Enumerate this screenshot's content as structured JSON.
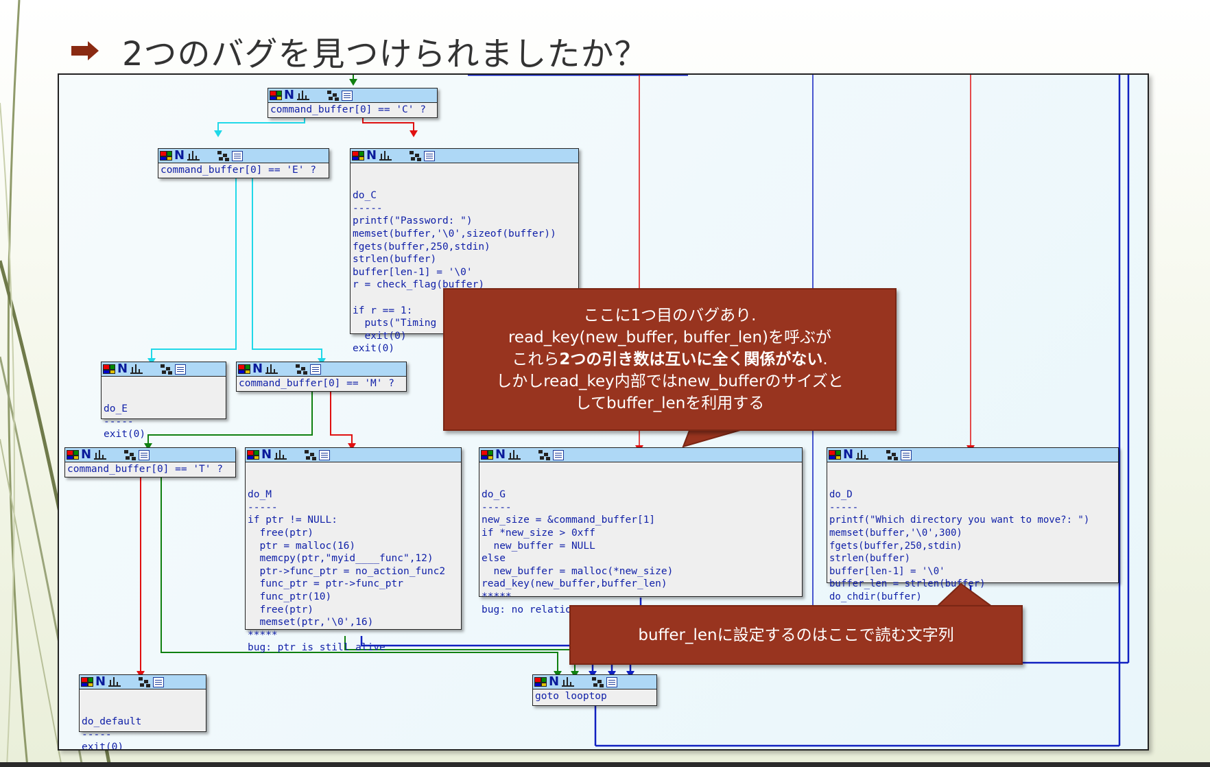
{
  "slide": {
    "title": "2つのバグを見つけられましたか？"
  },
  "nodes": {
    "n_c": {
      "lines": [
        "command_buffer[0] == 'C' ?"
      ]
    },
    "n_e": {
      "lines": [
        "command_buffer[0] == 'E' ?"
      ]
    },
    "do_c": {
      "lines": [
        "do_C",
        "-----",
        "printf(\"Password: \")",
        "memset(buffer,'\\0',sizeof(buffer))",
        "fgets(buffer,250,stdin)",
        "strlen(buffer)",
        "buffer[len-1] = '\\0'",
        "r = check_flag(buffer)",
        "",
        "if r == 1:",
        "  puts(\"Timing",
        "  exit(0)",
        "exit(0)"
      ]
    },
    "do_e": {
      "lines": [
        "do_E",
        "-----",
        "exit(0)"
      ]
    },
    "n_m": {
      "lines": [
        "command_buffer[0] == 'M' ?"
      ]
    },
    "n_t": {
      "lines": [
        "command_buffer[0] == 'T' ?"
      ]
    },
    "do_m": {
      "lines": [
        "do_M",
        "-----",
        "if ptr != NULL:",
        "  free(ptr)",
        "  ptr = malloc(16)",
        "  memcpy(ptr,\"myid____func\",12)",
        "  ptr->func_ptr = no_action_func2",
        "  func_ptr = ptr->func_ptr",
        "  func_ptr(10)",
        "  free(ptr)",
        "  memset(ptr,'\\0',16)",
        "*****",
        "bug: ptr is still alive"
      ]
    },
    "do_g": {
      "lines": [
        "do_G",
        "-----",
        "new_size = &command_buffer[1]",
        "if *new_size > 0xff",
        "  new_buffer = NULL",
        "else",
        "  new_buffer = malloc(*new_size)",
        "read_key(new_buffer,buffer_len)",
        "*****",
        "bug: no relation between new_buffer and buffer_len"
      ]
    },
    "do_d": {
      "lines": [
        "do_D",
        "-----",
        "printf(\"Which directory you want to move?: \")",
        "memset(buffer,'\\0',300)",
        "fgets(buffer,250,stdin)",
        "strlen(buffer)",
        "buffer[len-1] = '\\0'",
        "buffer_len = strlen(buffer)",
        "do_chdir(buffer)"
      ]
    },
    "do_default": {
      "lines": [
        "do_default",
        "-----",
        "exit(0)"
      ]
    },
    "goto": {
      "lines": [
        "goto looptop"
      ]
    }
  },
  "callouts": {
    "bug1": {
      "line1": "ここに1つ目のバグあり.",
      "line2": "read_key(new_buffer, buffer_len)を呼ぶが",
      "line3_a": "これら",
      "line3_b": "2つの引き数は互いに全く関係がない",
      "line3_c": ".",
      "line4": "しかしread_key内部ではnew_bufferのサイズと",
      "line5": "してbuffer_lenを利用する"
    },
    "bug2": {
      "text": "buffer_lenに設定するのはここで読む文字列"
    }
  },
  "colors": {
    "edge_true": "#108010",
    "edge_false": "#e01010",
    "edge_cyan": "#20d8e8",
    "edge_blue": "#1020c0",
    "callout_bg": "#98341f",
    "node_header": "#aed8f6",
    "code_text": "#1020a8"
  }
}
